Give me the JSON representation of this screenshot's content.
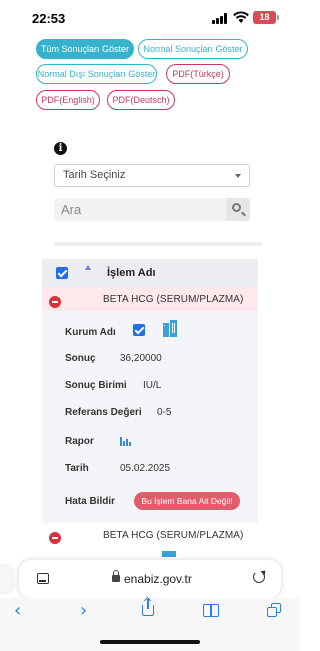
{
  "status_bar": {
    "time": "22:53",
    "battery": "18"
  },
  "filters": {
    "all_results": "Tüm Sonuçları Göster",
    "normal_results": "Normal Sonuçları Göster",
    "abnormal_results": "Normal Dışı Sonuçları Göster",
    "pdf_turkish": "PDF(Türkçe)",
    "pdf_english": "PDF(English)",
    "pdf_german": "PDF(Deutsch)"
  },
  "date_select": {
    "value": "Tarih Seçiniz"
  },
  "search": {
    "placeholder": "Ara"
  },
  "table": {
    "column_header": "İşlem Adı",
    "rows": [
      {
        "title": "BETA HCG (SERUM/PLAZMA)",
        "labels": {
          "institution": "Kurum Adı",
          "result": "Sonuç",
          "unit": "Sonuç Birimi",
          "reference": "Referans Değeri",
          "report": "Rapor",
          "date": "Tarih",
          "report_error": "Hata Bildir"
        },
        "values": {
          "result": "36,20000",
          "unit": "IU/L",
          "reference": "0-5",
          "date": "05.02.2025"
        },
        "report_error_button": "Bu İşlem Bana Ait Değil!"
      },
      {
        "title": "BETA HCG (SERUM/PLAZMA)"
      }
    ]
  },
  "browser": {
    "url": "enabiz.gov.tr"
  },
  "colors": {
    "accent_teal": "#35b3cc",
    "accent_red": "#c9375f",
    "link_blue": "#2b7de9"
  },
  "icons": [
    "info-icon",
    "search-icon",
    "sort-asc-icon",
    "minus-circle-icon",
    "building-icon",
    "chart-icon",
    "lock-icon",
    "reload-icon",
    "back-icon",
    "forward-icon",
    "share-icon",
    "bookmarks-icon",
    "tabs-icon"
  ]
}
